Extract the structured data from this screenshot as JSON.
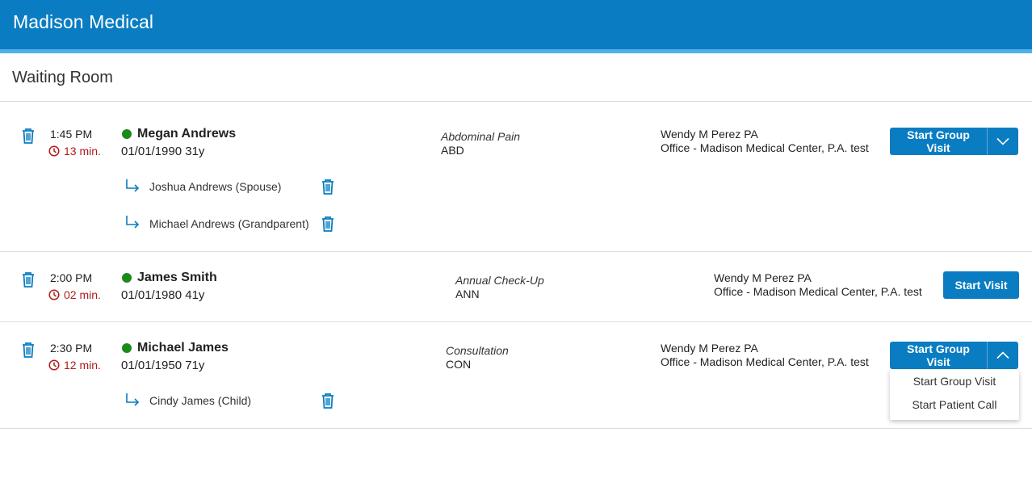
{
  "header": {
    "title": "Madison Medical"
  },
  "page": {
    "title": "Waiting Room"
  },
  "visits": [
    {
      "time": "1:45 PM",
      "wait": "13 min.",
      "patient": "Megan Andrews",
      "dob": "01/01/1990 31y",
      "reason": "Abdominal Pain",
      "code": "ABD",
      "provider": "Wendy M Perez PA",
      "office": "Office - Madison Medical Center, P.A. test",
      "action": "Start Group Visit",
      "related": [
        "Joshua Andrews (Spouse)",
        "Michael Andrews (Grandparent)"
      ]
    },
    {
      "time": "2:00 PM",
      "wait": "02 min.",
      "patient": "James Smith",
      "dob": "01/01/1980 41y",
      "reason": "Annual Check-Up",
      "code": "ANN",
      "provider": "Wendy M Perez PA",
      "office": "Office - Madison Medical Center, P.A. test",
      "action": "Start Visit",
      "related": []
    },
    {
      "time": "2:30 PM",
      "wait": "12 min.",
      "patient": "Michael James",
      "dob": "01/01/1950 71y",
      "reason": "Consultation",
      "code": "CON",
      "provider": "Wendy M Perez PA",
      "office": "Office - Madison Medical Center, P.A. test",
      "action": "Start Group Visit",
      "related": [
        "Cindy James (Child)"
      ]
    }
  ],
  "dropdown": {
    "items": [
      "Start Group Visit",
      "Start Patient Call"
    ]
  },
  "colors": {
    "brand": "#0a7dc2",
    "accent": "#4fb0e8",
    "online": "#1a8a1a",
    "wait": "#b01c1c"
  }
}
